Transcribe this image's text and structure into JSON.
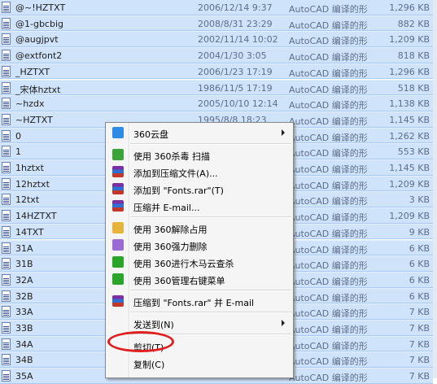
{
  "files": [
    {
      "name": "@~!HZTXT",
      "date": "2006/12/14 9:37",
      "type": "AutoCAD 编译的形",
      "size": "1,296 KB"
    },
    {
      "name": "@1-gbcbig",
      "date": "2008/8/31 23:29",
      "type": "AutoCAD 编译的形",
      "size": "882 KB"
    },
    {
      "name": "@augjpvt",
      "date": "2002/11/14 10:02",
      "type": "AutoCAD 编译的形",
      "size": "1,209 KB"
    },
    {
      "name": "@extfont2",
      "date": "2004/1/30 3:05",
      "type": "AutoCAD 编译的形",
      "size": "818 KB"
    },
    {
      "name": "_HZTXT",
      "date": "2006/1/23 17:19",
      "type": "AutoCAD 编译的形",
      "size": "1,296 KB"
    },
    {
      "name": "_宋体hztxt",
      "date": "1986/11/5 17:19",
      "type": "AutoCAD 编译的形",
      "size": "518 KB"
    },
    {
      "name": "~hzdx",
      "date": "2005/10/10 12:14",
      "type": "AutoCAD 编译的形",
      "size": "1,138 KB"
    },
    {
      "name": "~HZTXT",
      "date": "1995/8/8 18:23",
      "type": "AutoCAD 编译的形",
      "size": "1,145 KB"
    },
    {
      "name": "0",
      "date": "",
      "type": "AutoCAD 编译的形",
      "size": "1,262 KB"
    },
    {
      "name": "1",
      "date": "",
      "type": "AutoCAD 编译的形",
      "size": "553 KB"
    },
    {
      "name": "1hztxt",
      "date": "",
      "type": "AutoCAD 编译的形",
      "size": "1,145 KB"
    },
    {
      "name": "12hztxt",
      "date": "",
      "type": "AutoCAD 编译的形",
      "size": "1,209 KB"
    },
    {
      "name": "12txt",
      "date": "",
      "type": "AutoCAD 编译的形",
      "size": "3 KB"
    },
    {
      "name": "14HZTXT",
      "date": "",
      "type": "AutoCAD 编译的形",
      "size": "1,209 KB"
    },
    {
      "name": "14TXT",
      "date": "",
      "type": "AutoCAD 编译的形",
      "size": "9 KB"
    },
    {
      "name": "31A",
      "date": "",
      "type": "AutoCAD 编译的形",
      "size": "6 KB"
    },
    {
      "name": "31B",
      "date": "",
      "type": "AutoCAD 编译的形",
      "size": "6 KB"
    },
    {
      "name": "32A",
      "date": "",
      "type": "AutoCAD 编译的形",
      "size": "6 KB"
    },
    {
      "name": "32B",
      "date": "",
      "type": "AutoCAD 编译的形",
      "size": "6 KB"
    },
    {
      "name": "33A",
      "date": "",
      "type": "AutoCAD 编译的形",
      "size": "7 KB"
    },
    {
      "name": "33B",
      "date": "",
      "type": "AutoCAD 编译的形",
      "size": "7 KB"
    },
    {
      "name": "34A",
      "date": "",
      "type": "AutoCAD 编译的形",
      "size": "7 KB"
    },
    {
      "name": "34B",
      "date": "",
      "type": "AutoCAD 编译的形",
      "size": "7 KB"
    },
    {
      "name": "35A",
      "date": "",
      "type": "AutoCAD 编译的形",
      "size": "7 KB"
    }
  ],
  "menu": {
    "cloud": "360云盘",
    "scan": "使用 360杀毒 扫描",
    "add_archive": "添加到压缩文件(A)...",
    "add_fonts_rar": "添加到 \"Fonts.rar\"(T)",
    "compress_email": "压缩并 E-mail...",
    "unlock": "使用 360解除占用",
    "force_delete": "使用 360强力删除",
    "trojan_scan": "使用 360进行木马云查杀",
    "manage_menu": "使用 360管理右键菜单",
    "compress_fonts_email": "压缩到 \"Fonts.rar\" 并 E-mail",
    "send_to": "发送到(N)",
    "cut": "剪切(T)",
    "copy": "复制(C)"
  },
  "colors": {
    "selection": "#cfe3fb",
    "highlight_circle": "#e02020"
  }
}
